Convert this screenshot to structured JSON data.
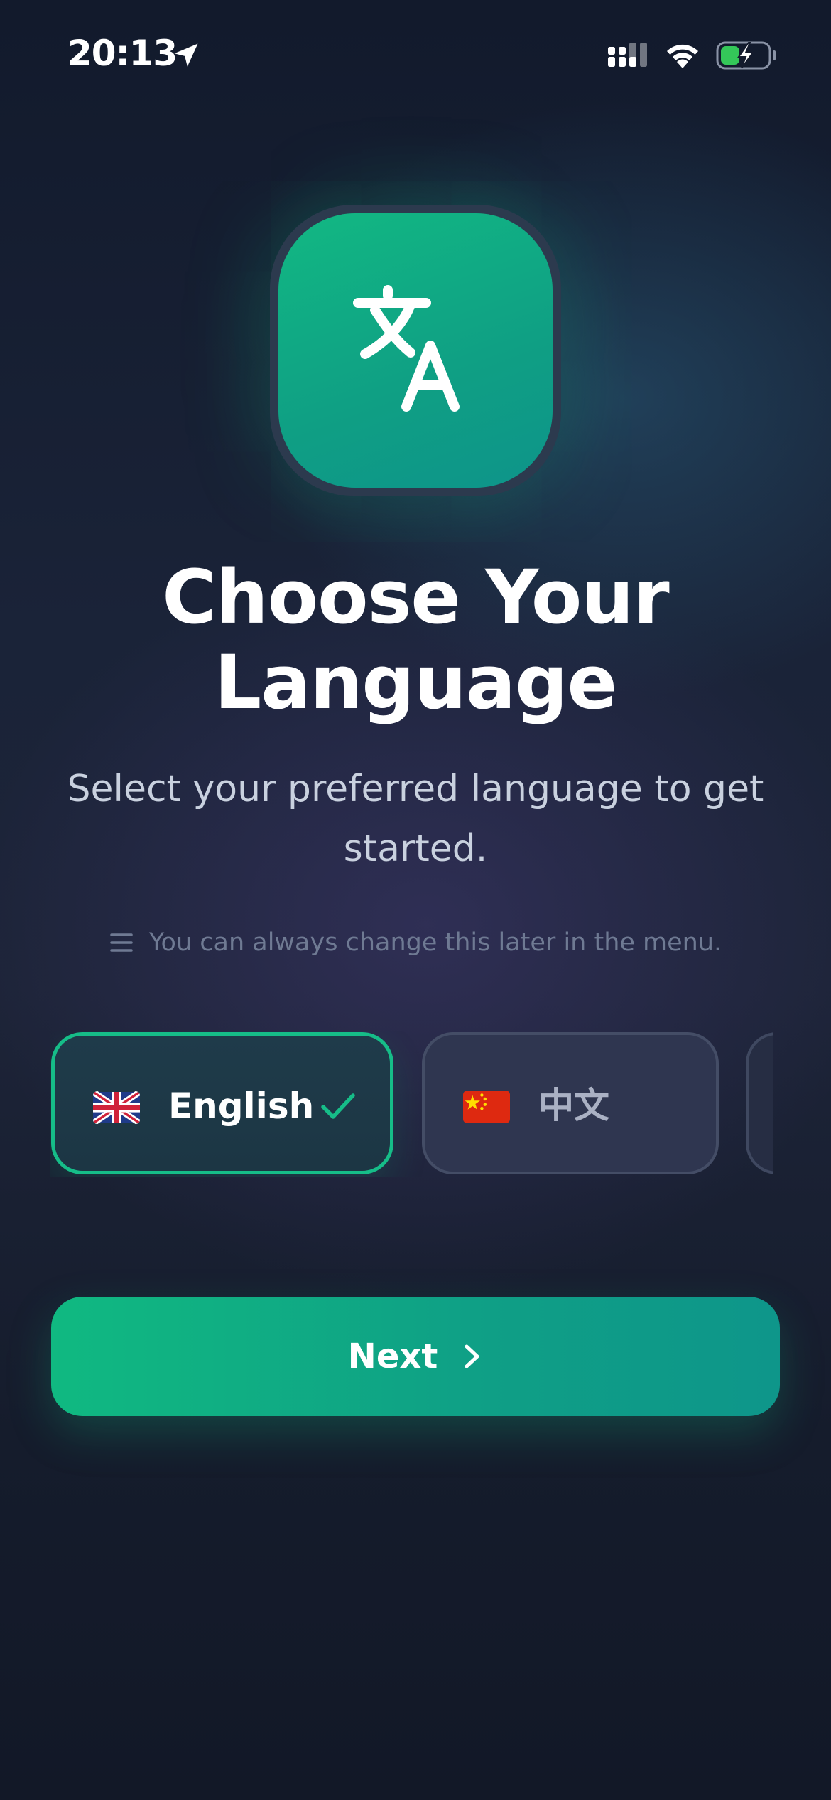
{
  "status_bar": {
    "time": "20:13",
    "icons": [
      "location-arrow-icon",
      "cellular-signal-icon",
      "wifi-icon",
      "battery-charging-icon"
    ]
  },
  "app_icon": {
    "name": "translate-icon"
  },
  "title": {
    "line1": "Choose Your",
    "line2": "Language"
  },
  "subtitle": "Select your preferred language to get started.",
  "hint": {
    "icon": "menu-icon",
    "text": "You can always change this later in the menu."
  },
  "languages": [
    {
      "flag": "uk-flag-icon",
      "label": "English",
      "selected": true
    },
    {
      "flag": "china-flag-icon",
      "label": "中文",
      "selected": false
    }
  ],
  "next_button": {
    "label": "Next",
    "icon": "chevron-right-icon"
  },
  "colors": {
    "accent": "#10B981",
    "accent_dark": "#0E968A",
    "background": "#141B2D",
    "card_bg": "#2F3650",
    "muted_text": "#6F7A93"
  }
}
